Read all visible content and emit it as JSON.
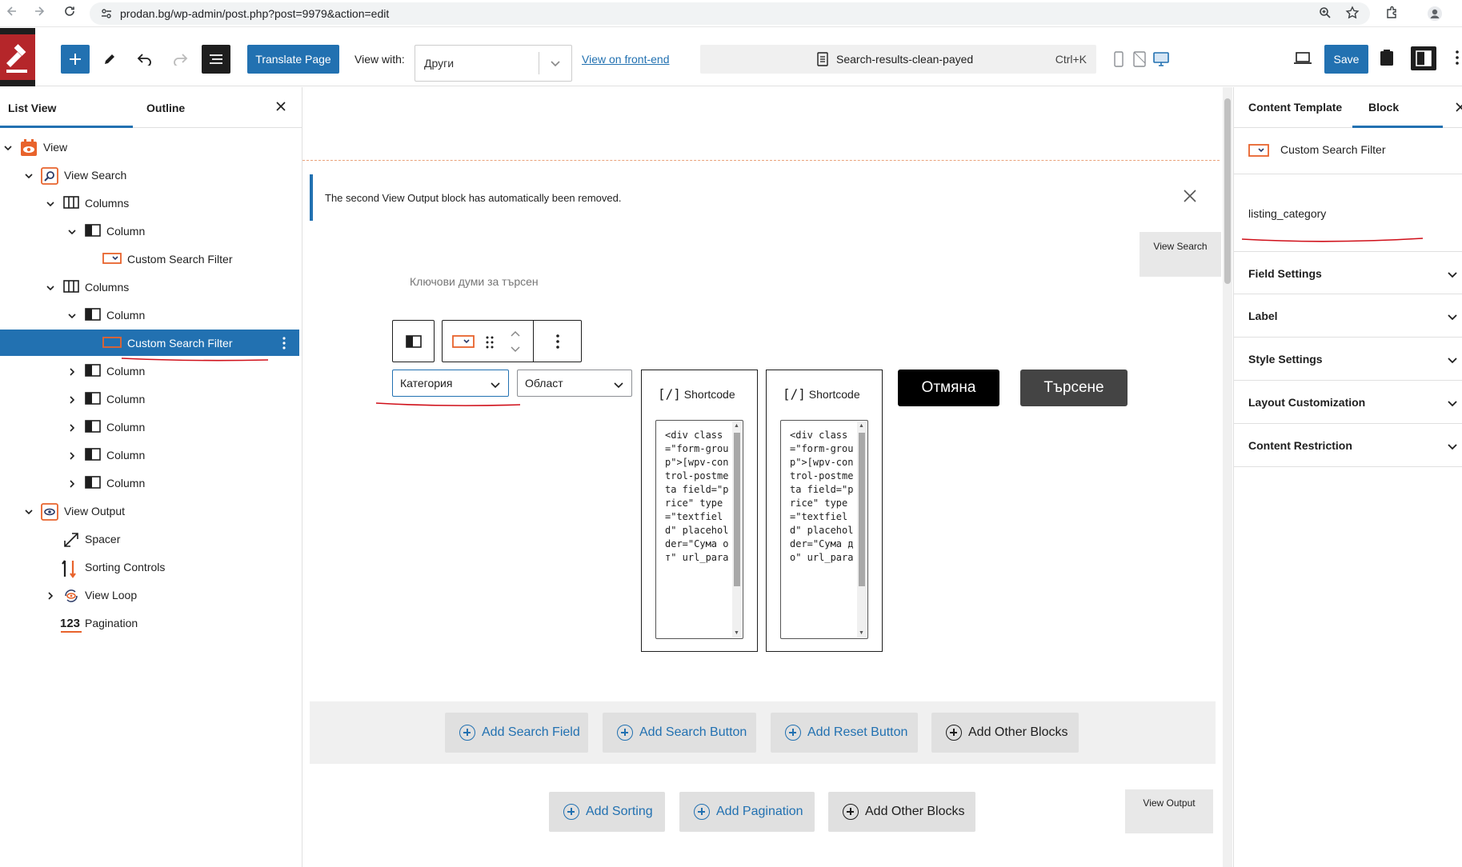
{
  "browser": {
    "url": "prodan.bg/wp-admin/post.php?post=9979&action=edit"
  },
  "toolbar": {
    "translate_label": "Translate Page",
    "view_with_label": "View with:",
    "view_with_value": "Други",
    "front_end_link": "View on front-end",
    "document_title": "Search-results-clean-payed",
    "shortcut": "Ctrl+K",
    "save_label": "Save"
  },
  "left_panel": {
    "tabs": [
      {
        "label": "List View"
      },
      {
        "label": "Outline"
      }
    ],
    "tree": [
      {
        "label": "View",
        "icon": "view-eye-icon"
      },
      {
        "label": "View Search",
        "icon": "search-icon"
      },
      {
        "label": "Columns",
        "icon": "columns-icon"
      },
      {
        "label": "Column",
        "icon": "column-icon"
      },
      {
        "label": "Custom Search Filter",
        "icon": "search-filter-icon"
      },
      {
        "label": "Columns",
        "icon": "columns-icon"
      },
      {
        "label": "Column",
        "icon": "column-icon"
      },
      {
        "label": "Custom Search Filter",
        "icon": "search-filter-icon"
      },
      {
        "label": "Column",
        "icon": "column-icon"
      },
      {
        "label": "Column",
        "icon": "column-icon"
      },
      {
        "label": "Column",
        "icon": "column-icon"
      },
      {
        "label": "Column",
        "icon": "column-icon"
      },
      {
        "label": "Column",
        "icon": "column-icon"
      },
      {
        "label": "View Output",
        "icon": "view-output-icon"
      },
      {
        "label": "Spacer",
        "icon": "spacer-icon"
      },
      {
        "label": "Sorting Controls",
        "icon": "sorting-icon"
      },
      {
        "label": "View Loop",
        "icon": "loop-icon"
      },
      {
        "label": "Pagination",
        "icon": "pagination-icon"
      }
    ]
  },
  "canvas": {
    "notice": "The second View Output block has automatically been removed.",
    "view_search_tag": "View Search",
    "keywords_label": "Ключови думи за търсен",
    "select_category": "Категория",
    "select_region": "Област",
    "shortcode_title": "Shortcode",
    "shortcode_1": "<div class=\"form-group\">[wpv-control-postmeta field=\"price\" type=\"textfield\" placeholder=\"Сума от\" url_para",
    "shortcode_2": "<div class=\"form-group\">[wpv-control-postmeta field=\"price\" type=\"textfield\" placeholder=\"Сума до\" url_para",
    "cancel_label": "Отмяна",
    "search_label": "Търсене",
    "add_buttons": [
      {
        "label": "Add Search Field"
      },
      {
        "label": "Add Search Button"
      },
      {
        "label": "Add Reset Button"
      },
      {
        "label": "Add Other Blocks"
      }
    ],
    "add_buttons_2": [
      {
        "label": "Add Sorting"
      },
      {
        "label": "Add Pagination"
      },
      {
        "label": "Add Other Blocks"
      }
    ],
    "view_output_tag": "View Output"
  },
  "right_panel": {
    "tabs": [
      {
        "label": "Content Template"
      },
      {
        "label": "Block"
      }
    ],
    "block_name": "Custom Search Filter",
    "field_name": "listing_category",
    "sections": [
      {
        "label": "Field Settings"
      },
      {
        "label": "Label"
      },
      {
        "label": "Style Settings"
      },
      {
        "label": "Layout Customization"
      },
      {
        "label": "Content Restriction"
      }
    ]
  },
  "colors": {
    "accent": "#2271b1",
    "toolset_orange": "#e8632c",
    "annotation_red": "#d0101a"
  }
}
